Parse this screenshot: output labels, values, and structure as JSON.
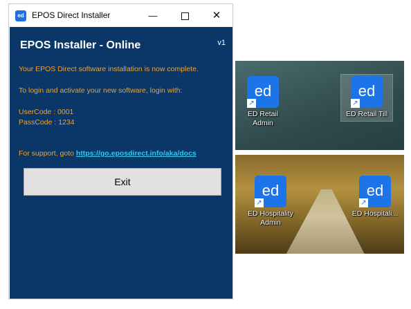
{
  "window": {
    "icon": "ed",
    "title": "EPOS Direct Installer",
    "controls": {
      "minimize": "—",
      "maximize": "",
      "close": "✕"
    }
  },
  "installer": {
    "heading": "EPOS Installer - Online",
    "version": "v1",
    "complete_msg": "Your EPOS Direct software installation is now complete.",
    "login_msg": "To login and activate your new software, login with:",
    "usercode": "UserCode : 0001",
    "passcode": "PassCode : 1234",
    "support_prefix": "For support, goto",
    "support_link": "https://go.eposdirect.info/aka/docs",
    "exit_label": "Exit"
  },
  "desktop": {
    "shortcuts_top": [
      {
        "icon": "ed",
        "label": "ED Retail Admin"
      },
      {
        "icon": "ed",
        "label": "ED Retail Till"
      }
    ],
    "shortcuts_bottom": [
      {
        "icon": "ed",
        "label": "ED Hospitality Admin"
      },
      {
        "icon": "ed",
        "label": "ED Hospitali..."
      }
    ],
    "shortcut_arrow": "↗"
  },
  "colors": {
    "panel_bg": "#0b3768",
    "message_text": "#f0a230",
    "link": "#32c7f0",
    "tile": "#1c74e8"
  }
}
